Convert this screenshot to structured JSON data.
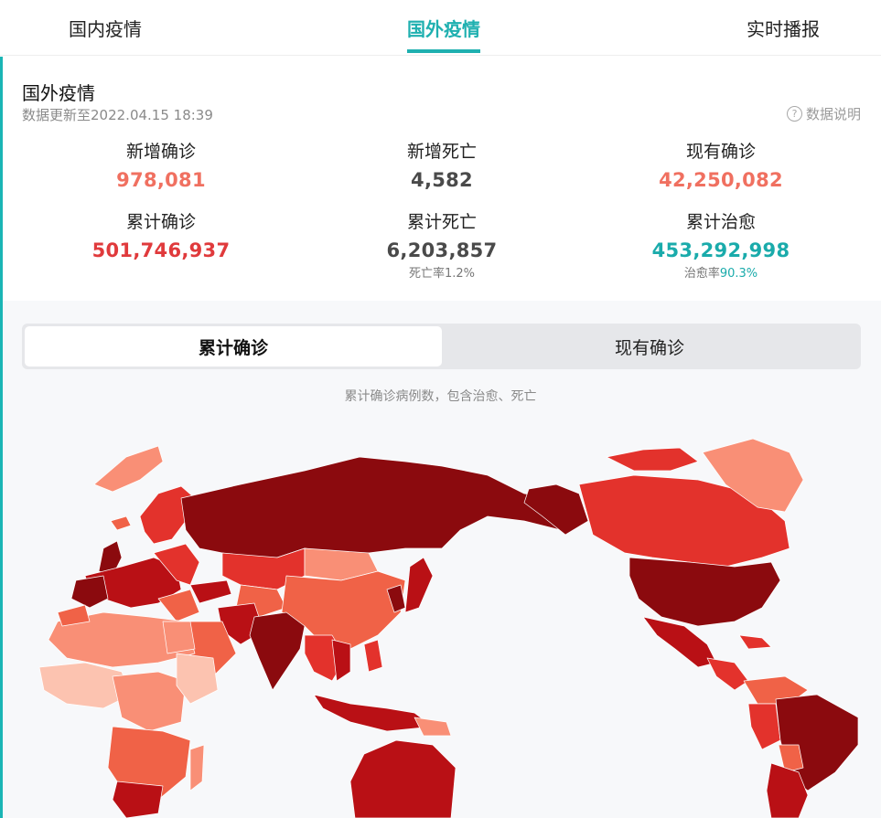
{
  "tabs": [
    {
      "label": "国内疫情"
    },
    {
      "label": "国外疫情"
    },
    {
      "label": "实时播报"
    }
  ],
  "summary": {
    "title": "国外疫情",
    "updated": "数据更新至2022.04.15 18:39",
    "data_note": "数据说明",
    "stats": {
      "new_confirmed": {
        "label": "新增确诊",
        "value": "978,081"
      },
      "new_deaths": {
        "label": "新增死亡",
        "value": "4,582"
      },
      "current_confirmed": {
        "label": "现有确诊",
        "value": "42,250,082"
      },
      "total_confirmed": {
        "label": "累计确诊",
        "value": "501,746,937"
      },
      "total_deaths": {
        "label": "累计死亡",
        "value": "6,203,857",
        "rate_label": "死亡率",
        "rate": "1.2%"
      },
      "total_recovered": {
        "label": "累计治愈",
        "value": "453,292,998",
        "rate_label": "治愈率",
        "rate": "90.3%"
      }
    }
  },
  "map": {
    "toggle": {
      "active": "累计确诊",
      "inactive": "现有确诊"
    },
    "caption": "累计确诊病例数，包含治愈、死亡"
  },
  "colors": {
    "accent": "#1fb0b0",
    "confirmed": "#e8494b",
    "confirmed_new": "#f07060",
    "deaths": "#4a4a4a",
    "recovered": "#1aabab",
    "map_level_1": "#fcc3b0",
    "map_level_2": "#f98f76",
    "map_level_3": "#f06247",
    "map_level_4": "#e3322c",
    "map_level_5": "#b91015",
    "map_level_6": "#8b0a0e"
  }
}
